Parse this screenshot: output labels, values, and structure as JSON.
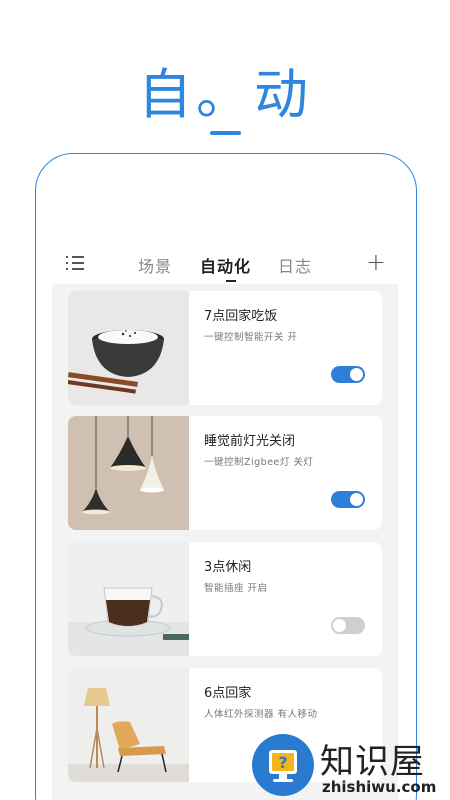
{
  "header": {
    "title": "自。动"
  },
  "tabs": {
    "items": [
      "场景",
      "自动化",
      "日志"
    ],
    "active_index": 1
  },
  "cards": [
    {
      "title": "7点回家吃饭",
      "desc": "一键控制智能开关  开",
      "enabled": true,
      "image": "rice-bowl-photo"
    },
    {
      "title": "睡觉前灯光关闭",
      "desc": "一键控制Zigbee灯  关灯",
      "enabled": true,
      "image": "pendant-lamps-photo"
    },
    {
      "title": "3点休闲",
      "desc": "智能插座  开启",
      "enabled": false,
      "image": "tea-cup-photo"
    },
    {
      "title": "6点回家",
      "desc": "人体红外探测器  有人移动",
      "enabled": false,
      "image": "lounge-chair-photo"
    }
  ],
  "watermark": {
    "name": "知识屋",
    "url": "zhishiwu.com"
  },
  "colors": {
    "accent": "#2e86de",
    "toggle_on": "#2e7fd8",
    "toggle_off": "#cfcfcf"
  }
}
